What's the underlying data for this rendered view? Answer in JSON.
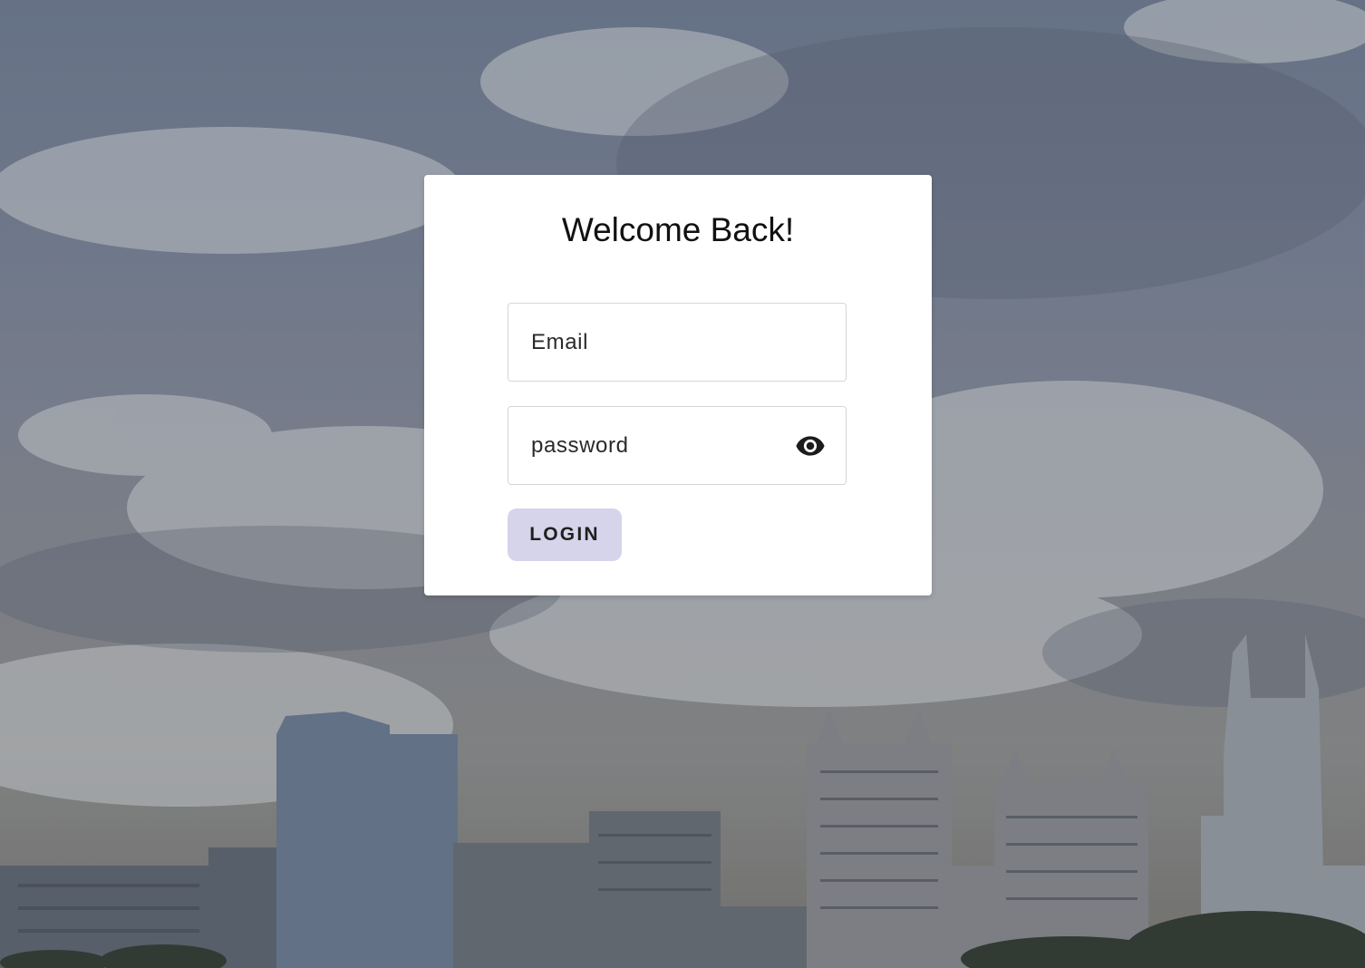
{
  "login": {
    "title": "Welcome Back!",
    "email_placeholder": "Email",
    "password_placeholder": "password",
    "login_label": "LOGIN",
    "toggle_icon": "eye-icon"
  },
  "colors": {
    "card_background": "#ffffff",
    "button_background": "#d5d4ea",
    "button_text": "#1f1f1f"
  }
}
